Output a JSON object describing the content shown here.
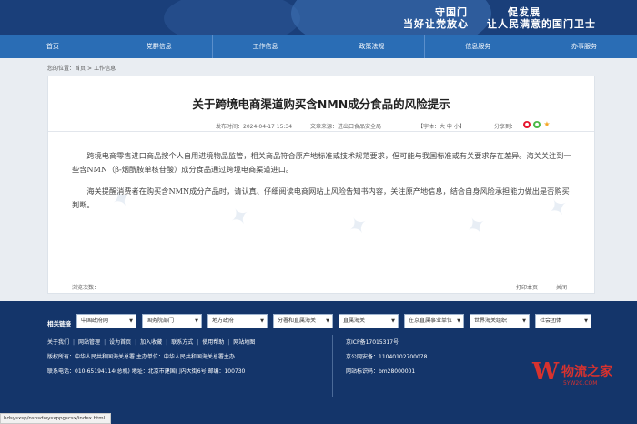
{
  "header": {
    "slogan_line1_a": "守国门",
    "slogan_line1_b": "促发展",
    "slogan_line2_a": "当好让党放心",
    "slogan_line2_b": "让人民满意的国门卫士"
  },
  "nav": {
    "items": [
      "首页",
      "党群信息",
      "工作信息",
      "政策法规",
      "信息服务",
      "办事服务"
    ]
  },
  "breadcrumb": {
    "prefix": "您的位置：",
    "home": "首页",
    "current": "工作信息"
  },
  "article": {
    "title": "关于跨境电商渠道购买含NMN成分食品的风险提示",
    "date": "发布时间：2024-04-17 15:34",
    "source": "文章来源：进出口食品安全局",
    "font_label": "【字体：大 中 小】",
    "share_label": "分享到：",
    "paragraph1": "跨境电商零售进口商品按个人自用进境物品监管，相关商品符合原产地标准或技术规范要求，但可能与我国标准或有关要求存在差异。海关关注到一些含NMN（β-烟酰胺单核苷酸）成分食品通过跨境电商渠道进口。",
    "paragraph2": "海关提醒消费者在购买含NMN成分产品时，请认真、仔细阅读电商网站上风险告知书内容，关注原产地信息，结合自身风险承担能力做出是否购买判断。",
    "views_label": "浏览次数：",
    "print_label": "打印本页",
    "close_label": "关闭"
  },
  "footer": {
    "links_label": "相关链接",
    "selects": [
      "中国政府网",
      "国务院部门",
      "地方政府",
      "分署和直属海关",
      "直属海关",
      "在京直属事业单位",
      "世界海关组织",
      "社会团体"
    ],
    "row1_links": [
      "关于我们",
      "网站管理",
      "设为首页",
      "加入收藏",
      "联系方式",
      "使用帮助",
      "网站地图"
    ],
    "row2": "版权所有：中华人民共和国海关总署 主办单位：中华人民共和国海关总署主办",
    "row3": "联系电话：010-65194114(总机) 地址：北京市建国门内大街6号 邮编：100730",
    "icp": "京ICP备17015317号",
    "police": "京公网安备：11040102700078",
    "site_code": "网站标识码：bm28000001",
    "status_url": "hdsysxsp/nshsdwysxppgscsx/index.html",
    "logo_letter": "W",
    "logo_text": "物流之家",
    "logo_sub": "5YW2C.COM"
  },
  "colors": {
    "banner": "#1a3f7a",
    "nav": "#2a6db5",
    "footer": "#14356a",
    "logo": "#d8322e"
  }
}
